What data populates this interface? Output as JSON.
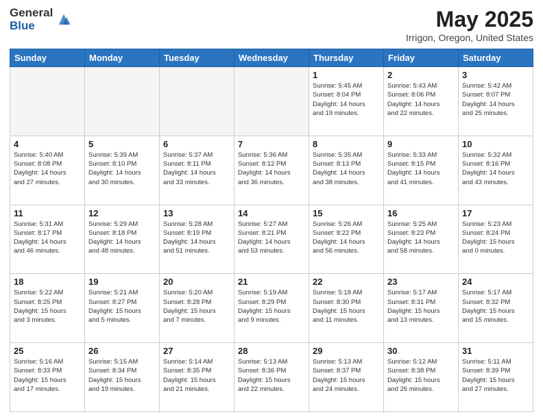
{
  "header": {
    "logo_general": "General",
    "logo_blue": "Blue",
    "main_title": "May 2025",
    "subtitle": "Irrigon, Oregon, United States"
  },
  "weekdays": [
    "Sunday",
    "Monday",
    "Tuesday",
    "Wednesday",
    "Thursday",
    "Friday",
    "Saturday"
  ],
  "weeks": [
    [
      {
        "day": "",
        "info": ""
      },
      {
        "day": "",
        "info": ""
      },
      {
        "day": "",
        "info": ""
      },
      {
        "day": "",
        "info": ""
      },
      {
        "day": "1",
        "info": "Sunrise: 5:45 AM\nSunset: 8:04 PM\nDaylight: 14 hours\nand 19 minutes."
      },
      {
        "day": "2",
        "info": "Sunrise: 5:43 AM\nSunset: 8:06 PM\nDaylight: 14 hours\nand 22 minutes."
      },
      {
        "day": "3",
        "info": "Sunrise: 5:42 AM\nSunset: 8:07 PM\nDaylight: 14 hours\nand 25 minutes."
      }
    ],
    [
      {
        "day": "4",
        "info": "Sunrise: 5:40 AM\nSunset: 8:08 PM\nDaylight: 14 hours\nand 27 minutes."
      },
      {
        "day": "5",
        "info": "Sunrise: 5:39 AM\nSunset: 8:10 PM\nDaylight: 14 hours\nand 30 minutes."
      },
      {
        "day": "6",
        "info": "Sunrise: 5:37 AM\nSunset: 8:11 PM\nDaylight: 14 hours\nand 33 minutes."
      },
      {
        "day": "7",
        "info": "Sunrise: 5:36 AM\nSunset: 8:12 PM\nDaylight: 14 hours\nand 36 minutes."
      },
      {
        "day": "8",
        "info": "Sunrise: 5:35 AM\nSunset: 8:13 PM\nDaylight: 14 hours\nand 38 minutes."
      },
      {
        "day": "9",
        "info": "Sunrise: 5:33 AM\nSunset: 8:15 PM\nDaylight: 14 hours\nand 41 minutes."
      },
      {
        "day": "10",
        "info": "Sunrise: 5:32 AM\nSunset: 8:16 PM\nDaylight: 14 hours\nand 43 minutes."
      }
    ],
    [
      {
        "day": "11",
        "info": "Sunrise: 5:31 AM\nSunset: 8:17 PM\nDaylight: 14 hours\nand 46 minutes."
      },
      {
        "day": "12",
        "info": "Sunrise: 5:29 AM\nSunset: 8:18 PM\nDaylight: 14 hours\nand 48 minutes."
      },
      {
        "day": "13",
        "info": "Sunrise: 5:28 AM\nSunset: 8:19 PM\nDaylight: 14 hours\nand 51 minutes."
      },
      {
        "day": "14",
        "info": "Sunrise: 5:27 AM\nSunset: 8:21 PM\nDaylight: 14 hours\nand 53 minutes."
      },
      {
        "day": "15",
        "info": "Sunrise: 5:26 AM\nSunset: 8:22 PM\nDaylight: 14 hours\nand 56 minutes."
      },
      {
        "day": "16",
        "info": "Sunrise: 5:25 AM\nSunset: 8:23 PM\nDaylight: 14 hours\nand 58 minutes."
      },
      {
        "day": "17",
        "info": "Sunrise: 5:23 AM\nSunset: 8:24 PM\nDaylight: 15 hours\nand 0 minutes."
      }
    ],
    [
      {
        "day": "18",
        "info": "Sunrise: 5:22 AM\nSunset: 8:25 PM\nDaylight: 15 hours\nand 3 minutes."
      },
      {
        "day": "19",
        "info": "Sunrise: 5:21 AM\nSunset: 8:27 PM\nDaylight: 15 hours\nand 5 minutes."
      },
      {
        "day": "20",
        "info": "Sunrise: 5:20 AM\nSunset: 8:28 PM\nDaylight: 15 hours\nand 7 minutes."
      },
      {
        "day": "21",
        "info": "Sunrise: 5:19 AM\nSunset: 8:29 PM\nDaylight: 15 hours\nand 9 minutes."
      },
      {
        "day": "22",
        "info": "Sunrise: 5:18 AM\nSunset: 8:30 PM\nDaylight: 15 hours\nand 11 minutes."
      },
      {
        "day": "23",
        "info": "Sunrise: 5:17 AM\nSunset: 8:31 PM\nDaylight: 15 hours\nand 13 minutes."
      },
      {
        "day": "24",
        "info": "Sunrise: 5:17 AM\nSunset: 8:32 PM\nDaylight: 15 hours\nand 15 minutes."
      }
    ],
    [
      {
        "day": "25",
        "info": "Sunrise: 5:16 AM\nSunset: 8:33 PM\nDaylight: 15 hours\nand 17 minutes."
      },
      {
        "day": "26",
        "info": "Sunrise: 5:15 AM\nSunset: 8:34 PM\nDaylight: 15 hours\nand 19 minutes."
      },
      {
        "day": "27",
        "info": "Sunrise: 5:14 AM\nSunset: 8:35 PM\nDaylight: 15 hours\nand 21 minutes."
      },
      {
        "day": "28",
        "info": "Sunrise: 5:13 AM\nSunset: 8:36 PM\nDaylight: 15 hours\nand 22 minutes."
      },
      {
        "day": "29",
        "info": "Sunrise: 5:13 AM\nSunset: 8:37 PM\nDaylight: 15 hours\nand 24 minutes."
      },
      {
        "day": "30",
        "info": "Sunrise: 5:12 AM\nSunset: 8:38 PM\nDaylight: 15 hours\nand 26 minutes."
      },
      {
        "day": "31",
        "info": "Sunrise: 5:11 AM\nSunset: 8:39 PM\nDaylight: 15 hours\nand 27 minutes."
      }
    ]
  ]
}
